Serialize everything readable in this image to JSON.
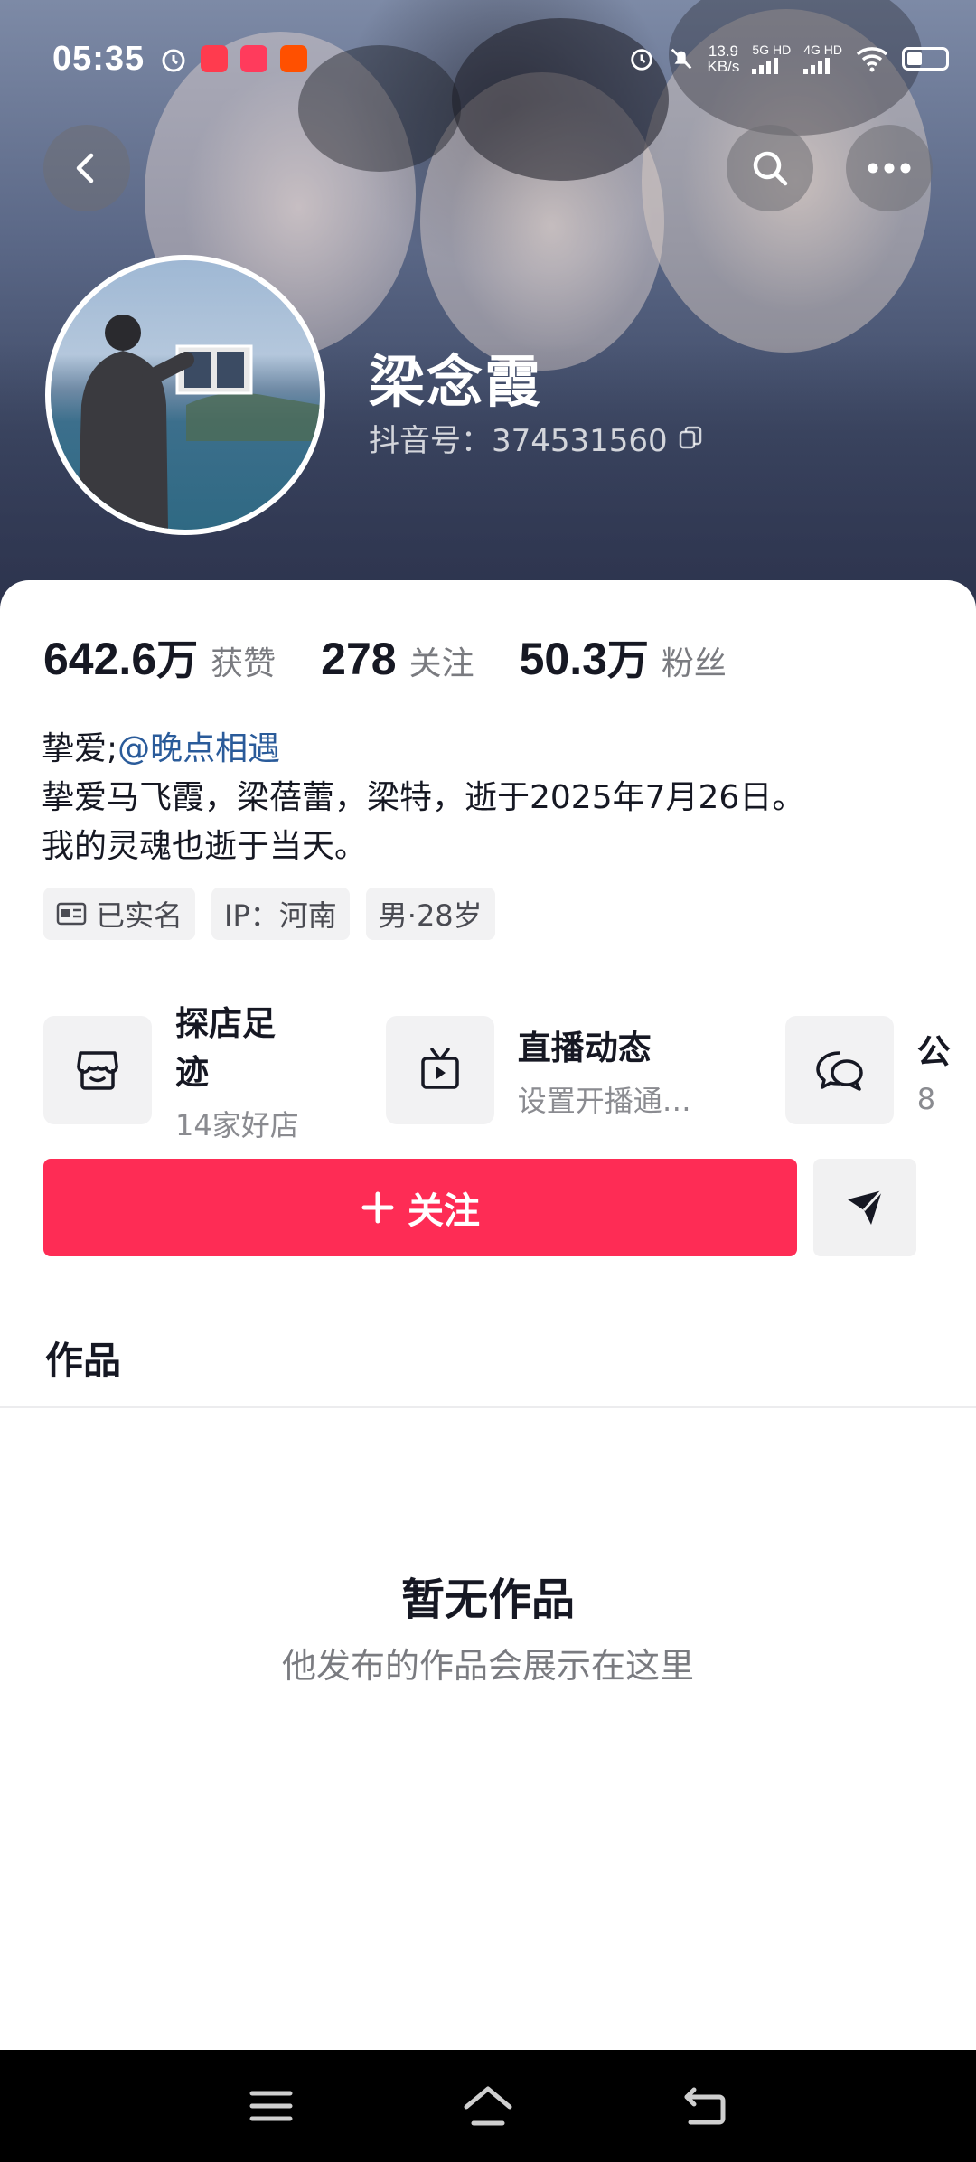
{
  "status_bar": {
    "time": "05:35",
    "net_speed_value": "13.9",
    "net_speed_unit": "KB/s",
    "sim1": "5G HD",
    "sim2": "4G HD",
    "colors": {
      "app1": "#ff3b4e",
      "app2": "#ff3b5c",
      "app3": "#ff5000"
    }
  },
  "profile": {
    "name": "梁念霞",
    "douyin_id": "抖音号：374531560"
  },
  "stats": [
    {
      "value": "642.6",
      "unit": "万",
      "label": "获赞"
    },
    {
      "value": "278",
      "unit": "",
      "label": "关注"
    },
    {
      "value": "50.3",
      "unit": "万",
      "label": "粉丝"
    }
  ],
  "bio": {
    "prefix": "挚爱;",
    "mention": "@晚点相遇",
    "line2": "挚爱马飞霞，梁蓓蕾，梁特，逝于2025年7月26日。",
    "line3": "我的灵魂也逝于当天。"
  },
  "tags": {
    "verified": "已实名",
    "ip": "IP：河南",
    "gender_age": "男·28岁"
  },
  "services": [
    {
      "title": "探店足迹",
      "sub": "14家好店",
      "icon": "shop-icon"
    },
    {
      "title": "直播动态",
      "sub": "设置开播通…",
      "icon": "tv-icon"
    },
    {
      "title": "公",
      "sub": "8",
      "icon": "chat-icon"
    }
  ],
  "actions": {
    "follow_label": "关注",
    "accent": "#fe2c55"
  },
  "works": {
    "tab_label": "作品",
    "empty_title": "暂无作品",
    "empty_sub": "他发布的作品会展示在这里"
  }
}
